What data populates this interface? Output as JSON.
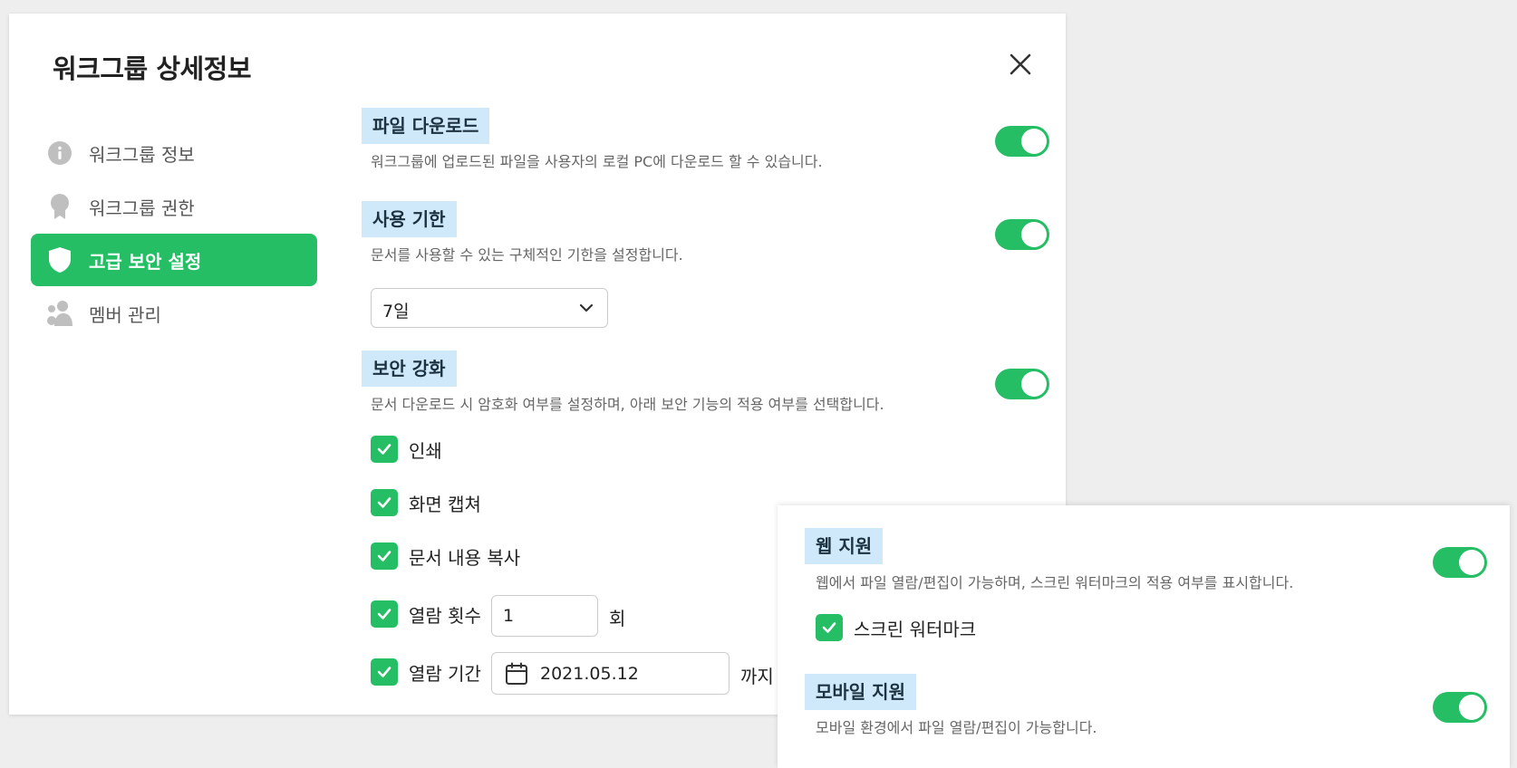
{
  "modal": {
    "title": "워크그룹 상세정보"
  },
  "sidebar": {
    "items": [
      {
        "label": "워크그룹 정보",
        "icon": "info-icon"
      },
      {
        "label": "워크그룹 권한",
        "icon": "badge-icon"
      },
      {
        "label": "고급 보안 설정",
        "icon": "shield-icon",
        "active": true
      },
      {
        "label": "멤버 관리",
        "icon": "members-icon"
      }
    ]
  },
  "sections": {
    "file_download": {
      "title": "파일 다운로드",
      "description": "워크그룹에 업로드된 파일을 사용자의 로컬 PC에 다운로드 할 수 있습니다.",
      "enabled": true
    },
    "usage_period": {
      "title": "사용 기한",
      "description": "문서를 사용할 수 있는 구체적인 기한을 설정합니다.",
      "enabled": true,
      "selected": "7일"
    },
    "security": {
      "title": "보안 강화",
      "description": "문서 다운로드 시 암호화 여부를 설정하며, 아래 보안 기능의 적용 여부를 선택합니다.",
      "enabled": true,
      "print": {
        "label": "인쇄",
        "checked": true
      },
      "screen_capture": {
        "label": "화면 캡쳐",
        "checked": true
      },
      "copy_content": {
        "label": "문서 내용 복사",
        "checked": true
      },
      "open_count": {
        "label": "열람 횟수",
        "checked": true,
        "value": "1",
        "suffix": "회"
      },
      "open_period": {
        "label": "열람 기간",
        "checked": true,
        "value": "2021.05.12",
        "suffix": "까지"
      }
    },
    "web_support": {
      "title": "웹 지원",
      "description": "웹에서 파일 열람/편집이 가능하며, 스크린 워터마크의 적용 여부를 표시합니다.",
      "enabled": true,
      "watermark": {
        "label": "스크린 워터마크",
        "checked": true
      }
    },
    "mobile_support": {
      "title": "모바일 지원",
      "description": "모바일 환경에서 파일 열람/편집이 가능합니다.",
      "enabled": true
    }
  },
  "colors": {
    "accent": "#26be65",
    "section_highlight": "#cfe9fb",
    "background": "#eeeeee"
  }
}
